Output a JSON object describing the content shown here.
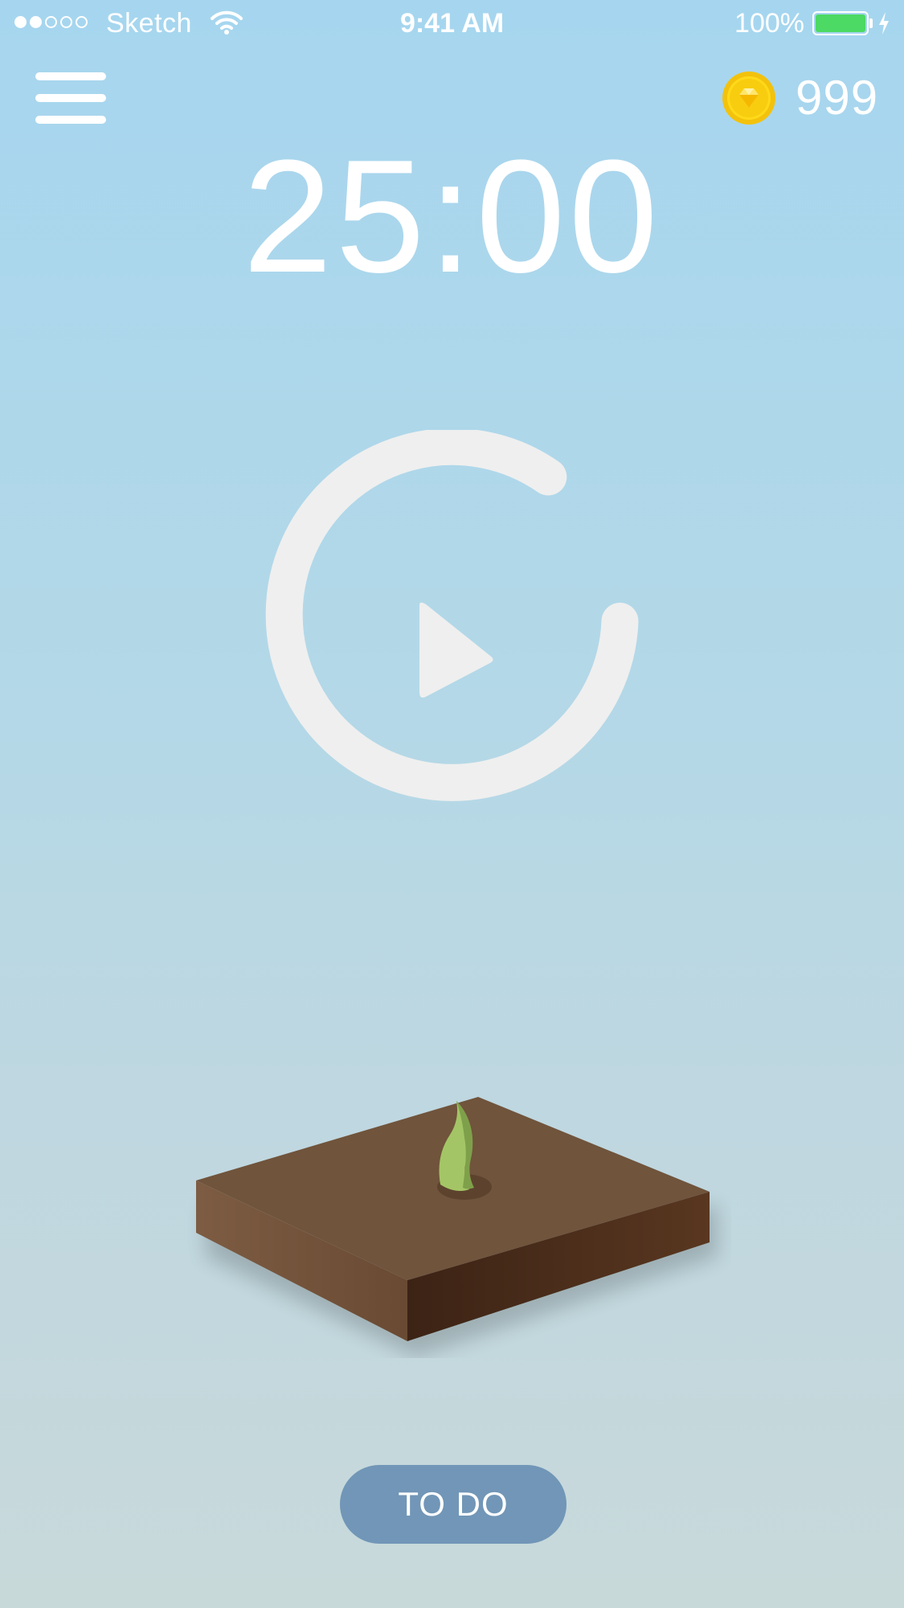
{
  "status_bar": {
    "signal_bars_filled": 2,
    "signal_bars_total": 5,
    "carrier": "Sketch",
    "time": "9:41 AM",
    "battery_percent": "100%",
    "battery_level": 1.0,
    "battery_color": "#4cd964",
    "icons": [
      "signal-dots-icon",
      "wifi-icon",
      "battery-icon",
      "charging-bolt-icon"
    ]
  },
  "header": {
    "menu_icon": "hamburger-menu-icon",
    "coin_icon": "coin-icon",
    "coin_count": "999"
  },
  "timer": {
    "display": "25:00",
    "play_icon": "play-icon",
    "ring_color": "#efefef"
  },
  "scene": {
    "plant": "seedling-icon",
    "ground": "soil-block"
  },
  "todo": {
    "label": "TO DO",
    "color": "#7196b7"
  },
  "theme": {
    "background_top": "#a6d6ef",
    "background_bottom": "#c8d9da",
    "soil_top": "#70543c",
    "soil_left": "#7a5a41",
    "soil_right": "#4b2e1d",
    "leaf_color": "#a4c566"
  }
}
